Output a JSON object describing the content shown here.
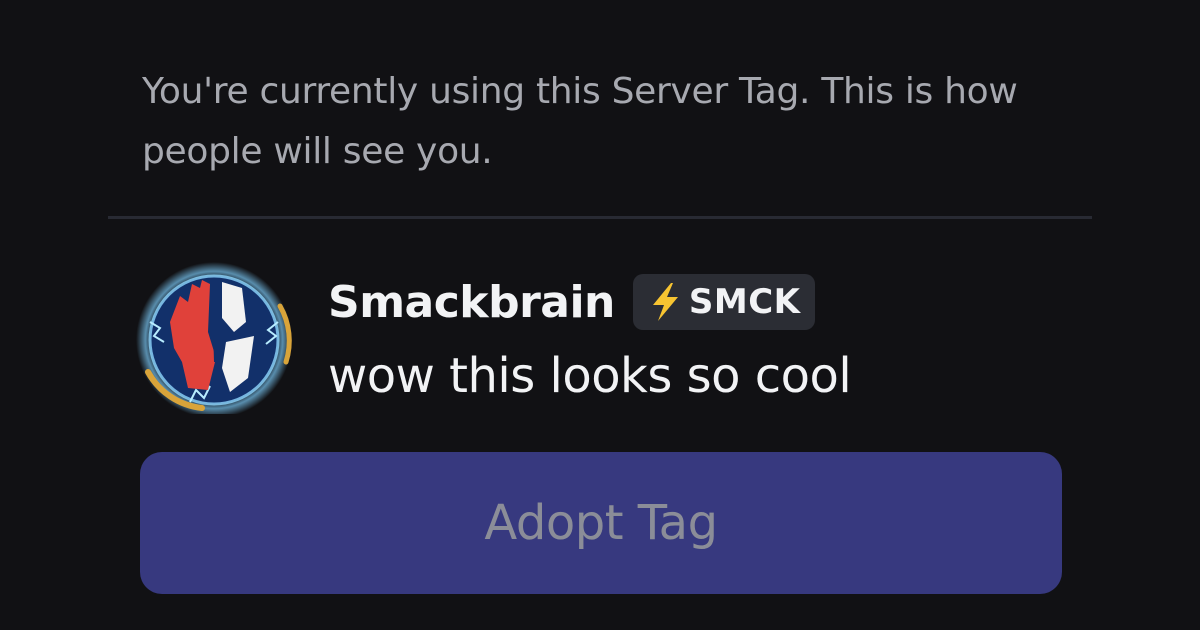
{
  "info": {
    "text": "You're currently using this Server Tag. This is how people will see you."
  },
  "preview": {
    "username": "Smackbrain",
    "tag": {
      "icon": "lightning-bolt-icon",
      "label": "SMCK",
      "icon_color": "#f7c431"
    },
    "message": "wow this looks so cool",
    "avatar": "team-logo-avatar"
  },
  "actions": {
    "adopt_label": "Adopt Tag"
  },
  "colors": {
    "background": "#111114",
    "button": "#37397f",
    "button_text": "#8b8d98",
    "badge_background": "#2b2d34"
  }
}
